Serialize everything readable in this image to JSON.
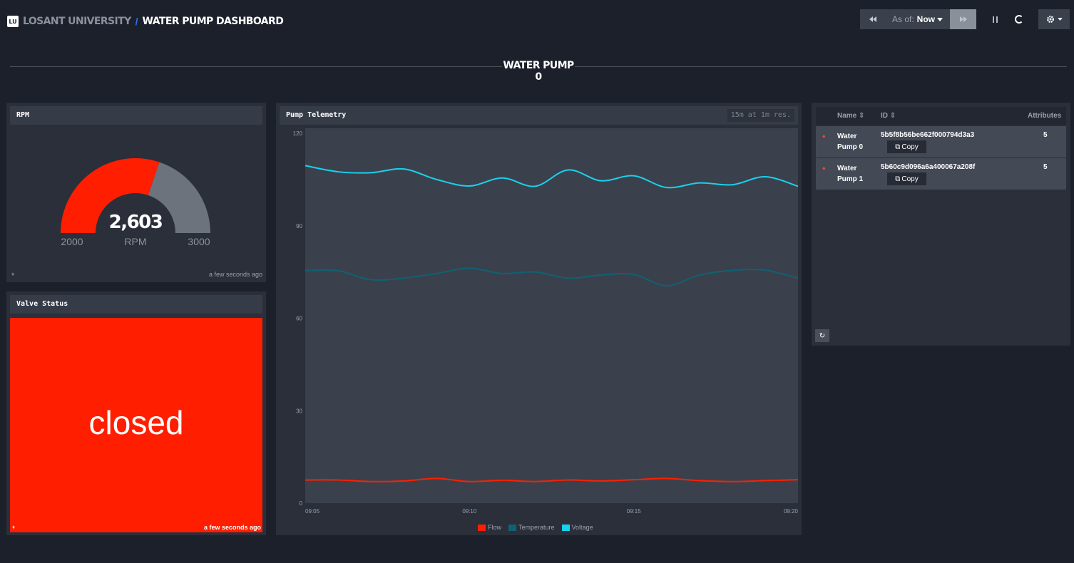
{
  "header": {
    "logo_text": "LU",
    "org_name": "LOSANT UNIVERSITY",
    "separator": "/",
    "dashboard_name": "WATER PUMP DASHBOARD"
  },
  "toolbar": {
    "rewind_icon": "rewind-icon",
    "as_of_label": "As of:",
    "as_of_value": "Now",
    "fast_forward_icon": "fast-forward-icon",
    "pause_icon": "pause-icon",
    "refresh_status_icon": "spinner-icon",
    "settings_icon": "gear-icon"
  },
  "section": {
    "title": "WATER PUMP 0"
  },
  "rpm_panel": {
    "title": "RPM",
    "value": "2,603",
    "unit": "RPM",
    "min": "2000",
    "max": "3000",
    "fill_fraction": 0.603,
    "fill_color": "#ff1f00",
    "track_color": "#6d737c",
    "updated": "a few seconds ago"
  },
  "valve_panel": {
    "title": "Valve Status",
    "status": "closed",
    "status_color": "#ff1f00",
    "updated": "a few seconds ago"
  },
  "telemetry_panel": {
    "title": "Pump Telemetry",
    "resolution": "15m at 1m res."
  },
  "chart_data": {
    "type": "line",
    "x": [
      "09:05",
      "09:06",
      "09:07",
      "09:08",
      "09:09",
      "09:10",
      "09:11",
      "09:12",
      "09:13",
      "09:14",
      "09:15",
      "09:16",
      "09:17",
      "09:18",
      "09:19",
      "09:20"
    ],
    "ylim": [
      0,
      120
    ],
    "yticks": [
      "0",
      "30",
      "60",
      "90",
      "120"
    ],
    "xticks": [
      "09:05",
      "09:10",
      "09:15",
      "09:20"
    ],
    "grid": false,
    "legend_position": "bottom-center",
    "series": [
      {
        "name": "Flow",
        "color": "#ff1f00",
        "values": [
          7.5,
          7.5,
          7.0,
          7.2,
          8.0,
          7.0,
          7.4,
          7.0,
          7.5,
          7.2,
          7.6,
          8.0,
          7.3,
          7.0,
          7.3,
          7.6
        ]
      },
      {
        "name": "Temperature",
        "color": "#0e6273",
        "values": [
          75.5,
          75.4,
          72.5,
          73.0,
          74.5,
          76.2,
          74.5,
          75.0,
          73.0,
          74.0,
          74.2,
          70.5,
          74.0,
          75.5,
          75.6,
          73.0
        ]
      },
      {
        "name": "Voltage",
        "color": "#18d1ee",
        "values": [
          109.5,
          107.5,
          107.2,
          108.4,
          105.0,
          102.9,
          105.5,
          102.8,
          108.1,
          104.6,
          106.2,
          102.4,
          103.9,
          103.3,
          105.9,
          102.8
        ]
      }
    ]
  },
  "device_table": {
    "columns": [
      "Name",
      "ID",
      "Attributes"
    ],
    "rows": [
      {
        "name": "Water Pump 0",
        "id": "5b5f8b56be662f000794d3a3",
        "attributes": "5",
        "copy_label": "Copy"
      },
      {
        "name": "Water Pump 1",
        "id": "5b60c9d096a6a400067a208f",
        "attributes": "5",
        "copy_label": "Copy"
      }
    ],
    "refresh_icon": "refresh-icon"
  }
}
